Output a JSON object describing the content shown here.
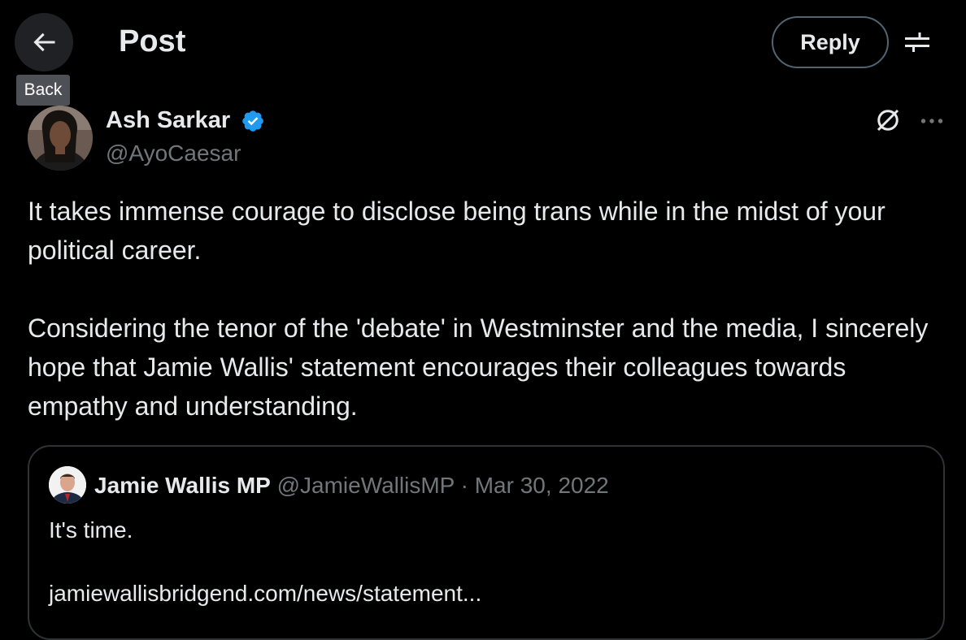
{
  "header": {
    "title": "Post",
    "back_tooltip": "Back",
    "reply_label": "Reply"
  },
  "post": {
    "author_name": "Ash Sarkar",
    "author_handle": "@AyoCaesar",
    "verified": true,
    "paragraphs": [
      "It takes immense courage to disclose being trans while in the midst of your political career.",
      "Considering the tenor of the 'debate' in Westminster and the media, I sincerely hope that Jamie Wallis' statement encourages their colleagues towards empathy and understanding."
    ]
  },
  "quote": {
    "author_name": "Jamie Wallis MP",
    "author_handle": "@JamieWallisMP",
    "separator": "·",
    "date": "Mar 30, 2022",
    "text": "It's time.",
    "link": "jamiewallisbridgend.com/news/statement..."
  },
  "icons": {
    "back": "arrow-left-icon",
    "filter": "sliders-icon",
    "verified": "verified-badge-icon",
    "grok": "grok-icon",
    "more": "more-horizontal-icon"
  },
  "colors": {
    "background": "#000000",
    "text": "#e7e9ea",
    "secondary_text": "#71767b",
    "verified_blue": "#1d9bf0",
    "border": "#2f3336"
  }
}
